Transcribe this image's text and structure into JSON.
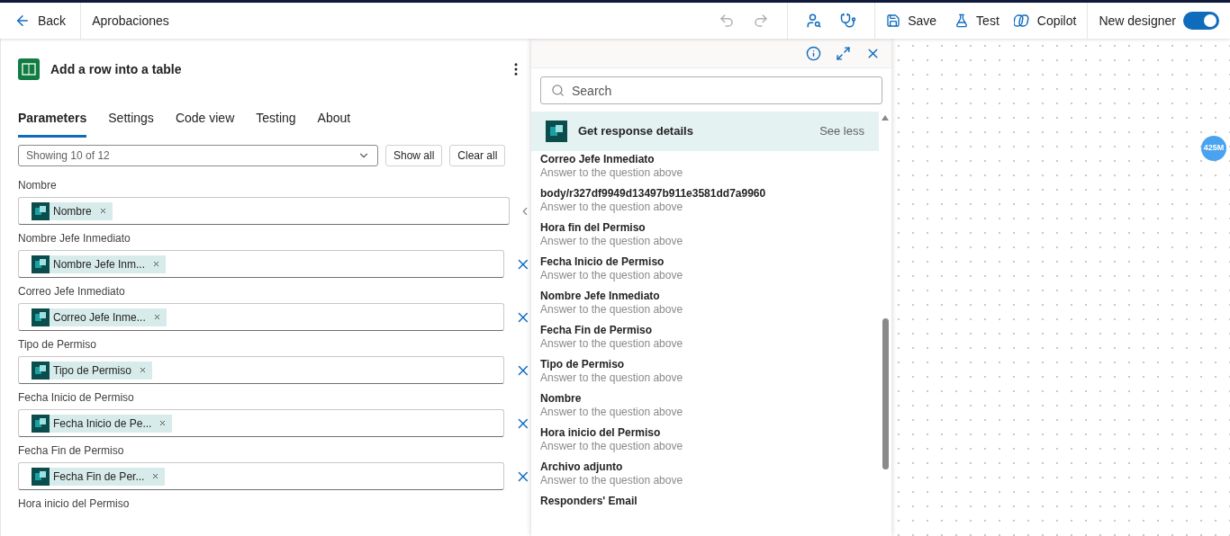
{
  "top_bar": {
    "back": "Back",
    "flow_name": "Aprobaciones",
    "save": "Save",
    "test": "Test",
    "copilot": "Copilot",
    "new_designer": {
      "label": "New designer",
      "on": true
    }
  },
  "action": {
    "title": "Add a row into a table"
  },
  "tabs": [
    {
      "label": "Parameters",
      "selected": true
    },
    {
      "label": "Settings",
      "selected": false
    },
    {
      "label": "Code view",
      "selected": false
    },
    {
      "label": "Testing",
      "selected": false
    },
    {
      "label": "About",
      "selected": false
    }
  ],
  "filter": {
    "value": "Showing 10 of 12",
    "show_all": "Show all",
    "clear_all": "Clear all"
  },
  "fields": [
    {
      "label": "Nombre",
      "token": "Nombre",
      "clearable": false
    },
    {
      "label": "Nombre Jefe Inmediato",
      "token": "Nombre Jefe Inm...",
      "clearable": true
    },
    {
      "label": "Correo Jefe Inmediato",
      "token": "Correo Jefe Inme...",
      "clearable": true
    },
    {
      "label": "Tipo de Permiso",
      "token": "Tipo de Permiso",
      "clearable": true
    },
    {
      "label": "Fecha Inicio de Permiso",
      "token": "Fecha Inicio de Pe...",
      "clearable": true
    },
    {
      "label": "Fecha Fin de Permiso",
      "token": "Fecha Fin de Per...",
      "clearable": true
    },
    {
      "label": "Hora inicio del Permiso"
    }
  ],
  "dynamic_content": {
    "search_placeholder": "Search",
    "group": {
      "title": "Get response details",
      "toggle": "See less"
    },
    "items": [
      {
        "title": "Correo Jefe Inmediato",
        "description": "Answer to the question above"
      },
      {
        "title": "body/r327df9949d13497b911e3581dd7a9960",
        "description": "Answer to the question above"
      },
      {
        "title": "Hora fin del Permiso",
        "description": "Answer to the question above"
      },
      {
        "title": "Fecha Inicio de Permiso",
        "description": "Answer to the question above"
      },
      {
        "title": "Nombre Jefe Inmediato",
        "description": "Answer to the question above"
      },
      {
        "title": "Fecha Fin de Permiso",
        "description": "Answer to the question above"
      },
      {
        "title": "Tipo de Permiso",
        "description": "Answer to the question above"
      },
      {
        "title": "Nombre",
        "description": "Answer to the question above"
      },
      {
        "title": "Hora inicio del Permiso",
        "description": "Answer to the question above"
      },
      {
        "title": "Archivo adjunto",
        "description": "Answer to the question above"
      },
      {
        "title": "Responders' Email"
      }
    ]
  },
  "canvas": {
    "badge": "425M"
  }
}
